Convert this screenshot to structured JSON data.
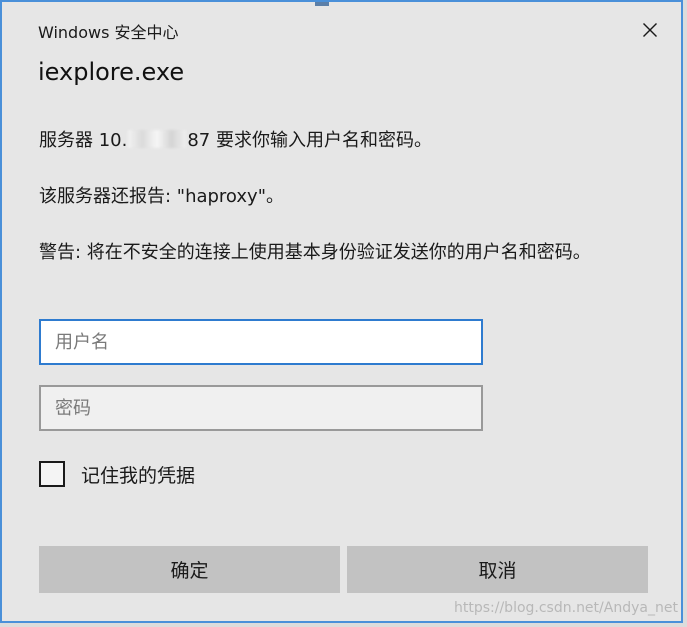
{
  "window": {
    "title": "Windows 安全中心",
    "close_icon": "close-icon"
  },
  "app": {
    "name": "iexplore.exe"
  },
  "messages": {
    "server_prefix": "服务器 10.",
    "server_suffix": "87 要求你输入用户名和密码。",
    "report": "该服务器还报告: \"haproxy\"。",
    "warning": "警告: 将在不安全的连接上使用基本身份验证发送你的用户名和密码。"
  },
  "form": {
    "username": {
      "value": "",
      "placeholder": "用户名"
    },
    "password": {
      "value": "",
      "placeholder": "密码"
    },
    "remember": {
      "label": "记住我的凭据",
      "checked": false
    }
  },
  "buttons": {
    "ok_label": "确定",
    "cancel_label": "取消"
  },
  "watermark": {
    "text": "https://blog.csdn.net/Andya_net"
  },
  "colors": {
    "focus_border": "#2e7bcf",
    "dialog_border": "#4a90d9",
    "dialog_background": "#e6e6e6",
    "button_background": "#c2c2c2"
  }
}
